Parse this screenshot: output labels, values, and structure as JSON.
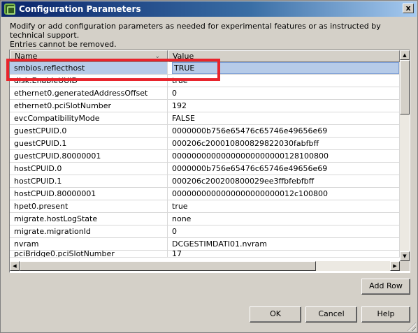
{
  "window": {
    "title": "Configuration Parameters",
    "close_label": "x"
  },
  "description": {
    "line1": "Modify or add configuration parameters as needed for experimental features or as instructed by technical support.",
    "line2": "Entries cannot be removed."
  },
  "table": {
    "columns": {
      "name": "Name",
      "value": "Value"
    },
    "selected_row": {
      "name": "smbios.reflecthost",
      "value": "TRUE"
    },
    "rows": [
      {
        "name": "disk.EnableUUID",
        "value": "true"
      },
      {
        "name": "ethernet0.generatedAddressOffset",
        "value": "0"
      },
      {
        "name": "ethernet0.pciSlotNumber",
        "value": "192"
      },
      {
        "name": "evcCompatibilityMode",
        "value": "FALSE"
      },
      {
        "name": "guestCPUID.0",
        "value": "0000000b756e65476c65746e49656e69"
      },
      {
        "name": "guestCPUID.1",
        "value": "000206c200010800829822030fabfbff"
      },
      {
        "name": "guestCPUID.80000001",
        "value": "00000000000000000000000128100800"
      },
      {
        "name": "hostCPUID.0",
        "value": "0000000b756e65476c65746e49656e69"
      },
      {
        "name": "hostCPUID.1",
        "value": "000206c200200800029ee3ffbfebfbff"
      },
      {
        "name": "hostCPUID.80000001",
        "value": "0000000000000000000000012c100800"
      },
      {
        "name": "hpet0.present",
        "value": "true"
      },
      {
        "name": "migrate.hostLogState",
        "value": "none"
      },
      {
        "name": "migrate.migrationId",
        "value": "0"
      },
      {
        "name": "nvram",
        "value": "DCGESTIMDATI01.nvram"
      },
      {
        "name": "pciBridge0.pciSlotNumber",
        "value": "17"
      }
    ]
  },
  "buttons": {
    "add_row": "Add Row",
    "ok": "OK",
    "cancel": "Cancel",
    "help": "Help"
  },
  "colors": {
    "highlight_box": "#e8242c",
    "titlebar": "#0a246a",
    "selected_row": "#b6cbe8"
  },
  "icons": {
    "app": "vsphere-app-icon",
    "close": "close-icon",
    "sort": "sort-arrow-icon"
  }
}
